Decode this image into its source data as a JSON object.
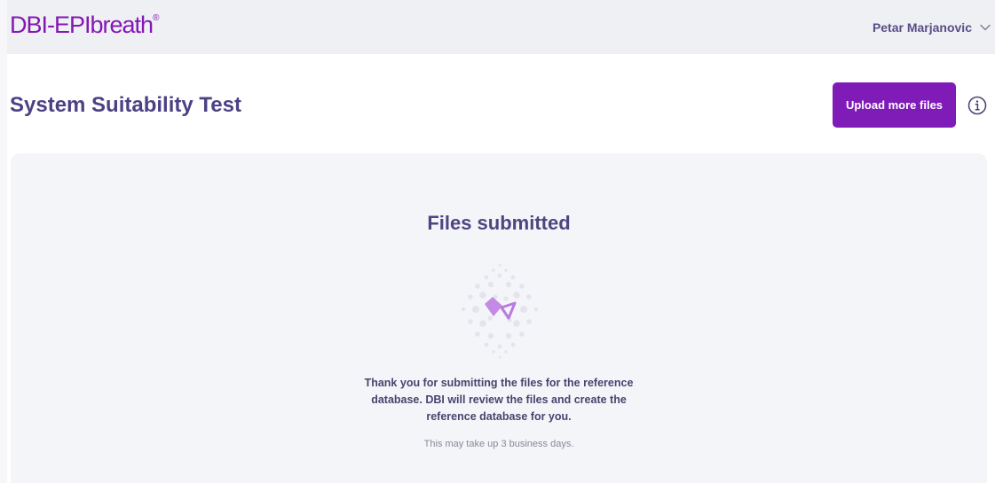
{
  "header": {
    "logo_text": "DBI-EPIbreath",
    "logo_mark": "®",
    "user_name": "Petar Marjanovic",
    "user_menu_icon": "chevron-down-icon"
  },
  "page": {
    "title": "System Suitability Test",
    "upload_button_label": "Upload more files",
    "info_icon": "info-icon"
  },
  "status_card": {
    "title": "Files submitted",
    "illustration_icon": "dotted-sphere-with-arrow-icon",
    "message": "Thank you for submitting the files for the reference database. DBI will review the files and create the reference database for you.",
    "note": "This may take up 3 business days."
  },
  "colors": {
    "brand": "#8417b5",
    "primary_button": "#7f1bb7",
    "heading": "#4d4185",
    "header_bg": "#eef0f4",
    "card_bg": "#f4f5f8",
    "illustration_accent": "#c48ae6"
  }
}
